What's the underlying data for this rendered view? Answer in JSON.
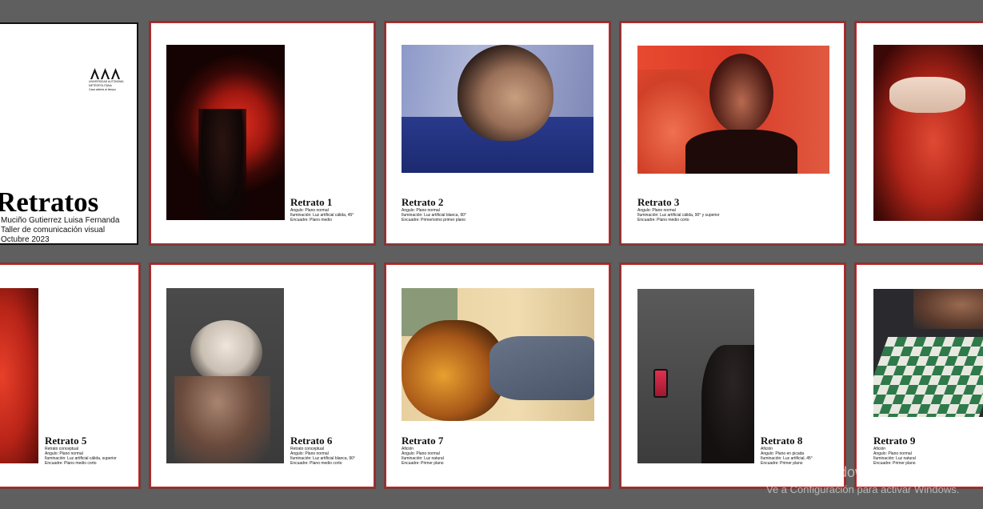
{
  "cover": {
    "title": "Retratos",
    "author": "Muciño Gutierrez Luisa Fernanda",
    "course": "Taller de comunicación visual",
    "date": "Octubre 2023",
    "logo_lines": [
      "UNIVERSIDAD AUTÓNOMA",
      "METROPOLITANA",
      "Casa abierta al tiempo"
    ]
  },
  "portraits": [
    {
      "title": "Retrato 1",
      "lines": [
        "Angulo: Plano normal",
        "Iluminación: Luz artificial cálida, 45°",
        "Encuadre: Plano medio"
      ]
    },
    {
      "title": "Retrato 2",
      "lines": [
        "Angulo: Plano normal",
        "Iluminación: Luz artificial blanca, 90°",
        "Encuadre: Primerísimo primer plano"
      ]
    },
    {
      "title": "Retrato 3",
      "lines": [
        "Angulo: Plano normal",
        "Iluminación: Luz artificial cálida, 90° y superior",
        "Encuadre: Plano medio corto"
      ]
    },
    {
      "title": "Retrato 5",
      "lines": [
        "Retrato conceptual",
        "Angulo: Plano normal",
        "Iluminación: Luz artificial cálida, superior",
        "Encuadre: Plano medio corto"
      ]
    },
    {
      "title": "Retrato 6",
      "lines": [
        "Retrato conceptual",
        "Angulo: Plano normal",
        "Iluminación: Luz artificial blanca, 90°",
        "Encuadre: Plano medio corto"
      ]
    },
    {
      "title": "Retrato 7",
      "lines": [
        "Afición",
        "Angulo: Plano normal",
        "Iluminación: Luz natural",
        "Encuadre: Primer plano"
      ]
    },
    {
      "title": "Retrato 8",
      "lines": [
        "Afición",
        "Angulo: Plano en picada",
        "Iluminación: Luz artificial, 45°",
        "Encuadre: Primer plano"
      ]
    },
    {
      "title": "Retrato 9",
      "lines": [
        "Afición",
        "Angulo: Plano normal",
        "Iluminación: Luz natural",
        "Encuadre: Primer plano"
      ]
    }
  ],
  "watermark": {
    "title": "Activar Windows",
    "subtitle": "Ve a Configuración para activar Windows."
  },
  "colors": {
    "canvas": "#5f5f5f",
    "artboard_border": "#c62828"
  }
}
